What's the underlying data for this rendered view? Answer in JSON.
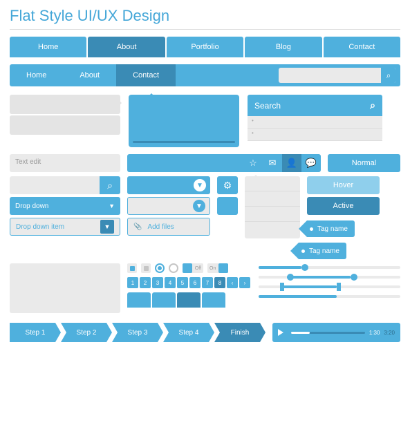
{
  "title": "Flat Style UI/UX Design",
  "nav1": [
    "Home",
    "About",
    "Portfolio",
    "Blog",
    "Contact"
  ],
  "nav1_active": 1,
  "nav2": [
    "Home",
    "About",
    "Contact"
  ],
  "nav2_active": 2,
  "search_placeholder": "",
  "list_search_label": "Search",
  "text_edit_placeholder": "Text edit",
  "buttons": {
    "normal": "Normal",
    "hover": "Hover",
    "active": "Active"
  },
  "dropdown_label": "Drop down",
  "dropdown_item": "Drop down item",
  "add_files": "Add files",
  "tag_name": "Tag name",
  "toggle": {
    "off": "Off",
    "on": "On"
  },
  "pager": [
    "1",
    "2",
    "3",
    "4",
    "5",
    "6",
    "7",
    "8",
    "‹",
    "›"
  ],
  "pager_current": 7,
  "steps": [
    "Step 1",
    "Step 2",
    "Step 3",
    "Step 4",
    "Finish"
  ],
  "player": {
    "current": "1:30",
    "total": "3:20"
  }
}
